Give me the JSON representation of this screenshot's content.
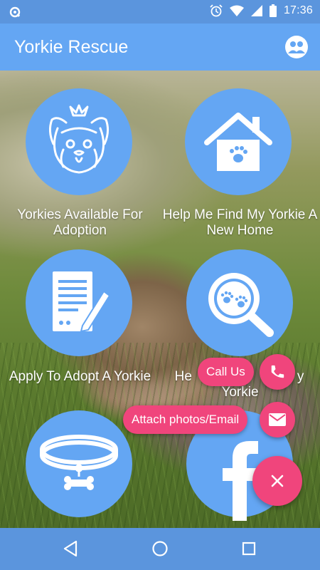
{
  "status_bar": {
    "time": "17:36",
    "icons": [
      "sync-icon",
      "alarm-icon",
      "wifi-icon",
      "signal-icon",
      "battery-icon"
    ]
  },
  "app_bar": {
    "title": "Yorkie Rescue",
    "account_icon": "people-icon"
  },
  "tiles": [
    {
      "label": "Yorkies Available For Adoption",
      "icon": "yorkie-face-icon"
    },
    {
      "label": "Help Me Find My Yorkie A New Home",
      "icon": "house-paw-icon"
    },
    {
      "label": "Apply To Adopt A Yorkie",
      "icon": "application-form-icon"
    },
    {
      "label_partial_left": "He",
      "label_partial_right": "y",
      "label_line2": "Yorkie",
      "icon": "search-paws-icon"
    },
    {
      "label": "",
      "icon": "dog-collar-icon"
    },
    {
      "label": "",
      "icon": "facebook-icon"
    }
  ],
  "fab": {
    "call_label": "Call Us",
    "email_label": "Attach photos/Email",
    "call_icon": "phone-icon",
    "email_icon": "mail-icon",
    "close_icon": "close-icon"
  },
  "nav": {
    "back_icon": "back-icon",
    "home_icon": "home-icon",
    "recents_icon": "recents-icon"
  },
  "colors": {
    "primary": "#64a6f3",
    "status_bar": "#5b95dd",
    "accent": "#f0457c"
  }
}
